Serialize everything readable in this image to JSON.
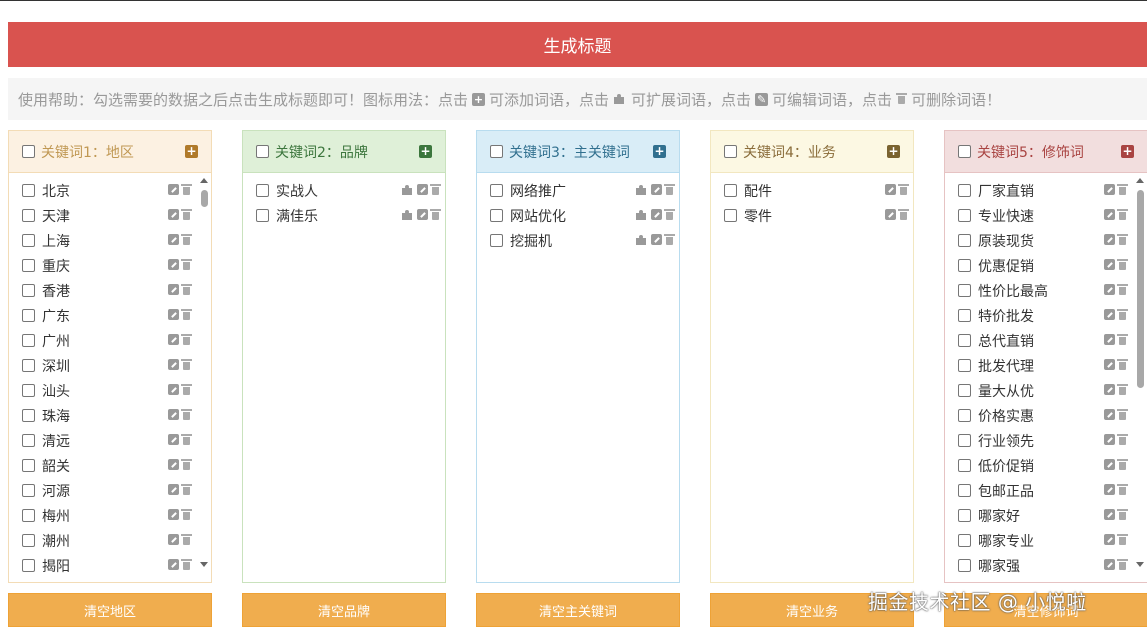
{
  "generate_button": "生成标题",
  "help": {
    "p1": "使用帮助：勾选需要的数据之后点击生成标题即可！图标用法：点击",
    "p2": "可添加词语，点击",
    "p3": "可扩展词语，点击",
    "p4": "可编辑词语，点击",
    "p5": "可删除词语！"
  },
  "panels": [
    {
      "title": "关键词1：地区",
      "title_color": "#c09853",
      "head_bg": "#fcf1e2",
      "border": "#f3dcb6",
      "add_color": "#b07a2a",
      "extend": false,
      "scrollbar": true,
      "items": [
        "北京",
        "天津",
        "上海",
        "重庆",
        "香港",
        "广东",
        "广州",
        "深圳",
        "汕头",
        "珠海",
        "清远",
        "韶关",
        "河源",
        "梅州",
        "潮州",
        "揭阳"
      ],
      "clear_label": "清空地区"
    },
    {
      "title": "关键词2：品牌",
      "title_color": "#3c763d",
      "head_bg": "#dff0d8",
      "border": "#c9e2bd",
      "add_color": "#3c763d",
      "extend": true,
      "scrollbar": false,
      "items": [
        "实战人",
        "满佳乐"
      ],
      "clear_label": "清空品牌"
    },
    {
      "title": "关键词3：主关键词",
      "title_color": "#31708f",
      "head_bg": "#d9edf7",
      "border": "#b8dcef",
      "add_color": "#31708f",
      "extend": true,
      "scrollbar": false,
      "items": [
        "网络推广",
        "网站优化",
        "挖掘机"
      ],
      "clear_label": "清空主关键词"
    },
    {
      "title": "关键词4：业务",
      "title_color": "#8a6d3b",
      "head_bg": "#fcf8e3",
      "border": "#f2e7c0",
      "add_color": "#7a6330",
      "extend": false,
      "scrollbar": false,
      "items": [
        "配件",
        "零件"
      ],
      "clear_label": "清空业务"
    },
    {
      "title": "关键词5：修饰词",
      "title_color": "#a94442",
      "head_bg": "#f2dede",
      "border": "#e6c3c3",
      "add_color": "#a94442",
      "extend": false,
      "scrollbar": true,
      "items": [
        "厂家直销",
        "专业快速",
        "原装现货",
        "优惠促销",
        "性价比最高",
        "特价批发",
        "总代直销",
        "批发代理",
        "量大从优",
        "价格实惠",
        "行业领先",
        "低价促销",
        "包邮正品",
        "哪家好",
        "哪家专业",
        "哪家强"
      ],
      "clear_label": "清空修饰词"
    }
  ],
  "watermark": "掘金技术社区 @ 小悦啦"
}
